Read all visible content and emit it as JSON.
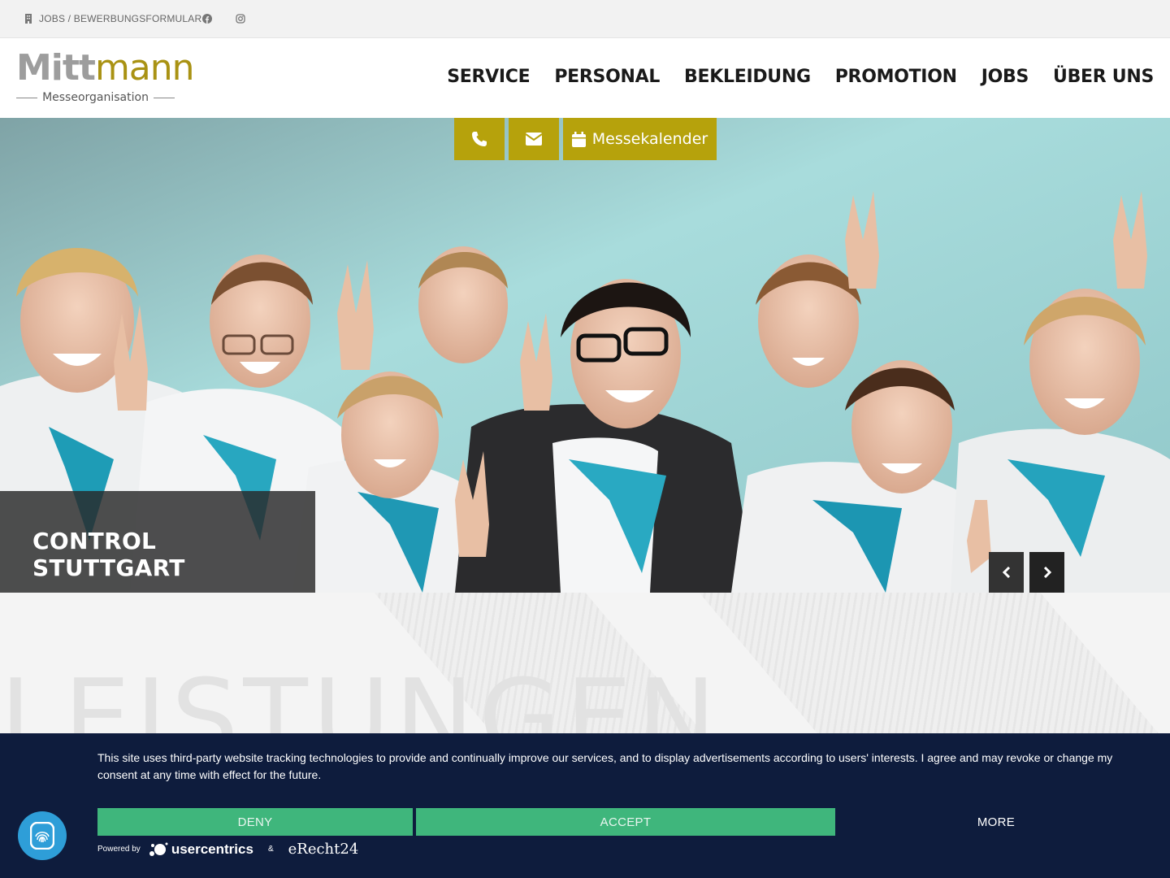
{
  "topbar": {
    "jobs_link": "JOBS / BEWERBUNGSFORMULAR",
    "icons": [
      "building-icon",
      "facebook-icon",
      "instagram-icon"
    ]
  },
  "logo": {
    "main_part1": "Mitt",
    "main_part2": "mann",
    "subtitle": "Messeorganisation"
  },
  "nav": {
    "items": [
      "SERVICE",
      "PERSONAL",
      "BEKLEIDUNG",
      "PROMOTION",
      "JOBS",
      "ÜBER UNS"
    ]
  },
  "quickbar": {
    "phone_icon": "phone-icon",
    "mail_icon": "envelope-icon",
    "calendar_label": "Messekalender",
    "accent": "#b6a20c"
  },
  "hero": {
    "caption": "CONTROL STUTTGART"
  },
  "section": {
    "heading": "LEISTUNGEN"
  },
  "cookie": {
    "text": "This site uses third-party website tracking technologies to provide and continually improve our services, and to display advertisements according to users' interests. I agree and may revoke or change my consent at any time with effect for the future.",
    "deny": "DENY",
    "accept": "ACCEPT",
    "more": "MORE",
    "powered_by": "Powered by",
    "amp": "&",
    "usercentrics": "usercentrics",
    "erecht": "eRecht24",
    "background": "#0e1c3d",
    "button_color": "#3fb67c"
  }
}
